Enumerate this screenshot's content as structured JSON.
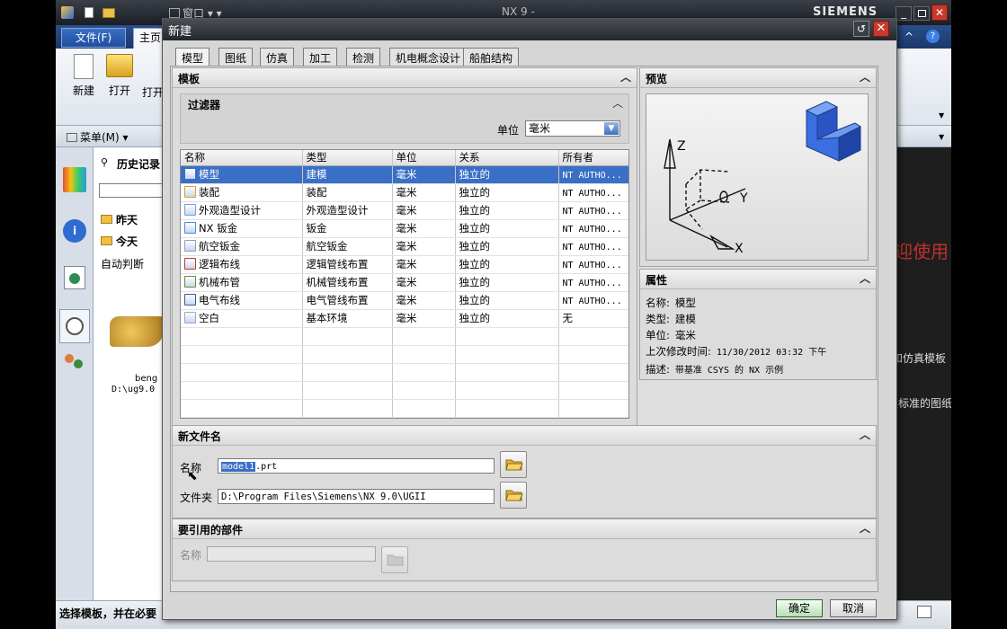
{
  "app": {
    "window_title": "NX 9 -",
    "brand": "SIEMENS",
    "qa_window_menu": "窗口",
    "file_tab": "文件(F)",
    "home_tab": "主页",
    "ribbon_new": "新建",
    "ribbon_open": "打开",
    "ribbon_open_recent": "打开",
    "menu_button": "菜单(M)",
    "history_title": "历史记录",
    "history_yesterday": "昨天",
    "history_today": "今天",
    "history_auto": "自动判断",
    "history_item_name": "beng",
    "history_item_path": "D:\\ug9.0",
    "right_welcome": "欢迎使用",
    "right_text1": "和仿真模板",
    "right_text2": "义标准的图纸",
    "status_text": "选择模板，并在必要"
  },
  "dialog": {
    "title": "新建",
    "tabs": [
      "模型",
      "图纸",
      "仿真",
      "加工",
      "检测",
      "机电概念设计",
      "船舶结构"
    ],
    "templates_header": "模板",
    "filter_header": "过滤器",
    "unit_label": "单位",
    "unit_value": "毫米",
    "columns": [
      "名称",
      "类型",
      "单位",
      "关系",
      "所有者"
    ],
    "rows": [
      {
        "name": "模型",
        "type": "建模",
        "unit": "毫米",
        "relation": "独立的",
        "owner": "NT AUTHO..."
      },
      {
        "name": "装配",
        "type": "装配",
        "unit": "毫米",
        "relation": "独立的",
        "owner": "NT AUTHO..."
      },
      {
        "name": "外观造型设计",
        "type": "外观造型设计",
        "unit": "毫米",
        "relation": "独立的",
        "owner": "NT AUTHO..."
      },
      {
        "name": "NX 钣金",
        "type": "钣金",
        "unit": "毫米",
        "relation": "独立的",
        "owner": "NT AUTHO..."
      },
      {
        "name": "航空钣金",
        "type": "航空钣金",
        "unit": "毫米",
        "relation": "独立的",
        "owner": "NT AUTHO..."
      },
      {
        "name": "逻辑布线",
        "type": "逻辑管线布置",
        "unit": "毫米",
        "relation": "独立的",
        "owner": "NT AUTHO..."
      },
      {
        "name": "机械布管",
        "type": "机械管线布置",
        "unit": "毫米",
        "relation": "独立的",
        "owner": "NT AUTHO..."
      },
      {
        "name": "电气布线",
        "type": "电气管线布置",
        "unit": "毫米",
        "relation": "独立的",
        "owner": "NT AUTHO..."
      },
      {
        "name": "空白",
        "type": "基本环境",
        "unit": "毫米",
        "relation": "独立的",
        "owner": "无"
      }
    ],
    "preview_header": "预览",
    "preview_axis_z": "Z",
    "preview_axis_y": "Y",
    "preview_axis_x": "X",
    "properties_header": "属性",
    "properties": [
      {
        "label": "名称:",
        "value": "模型"
      },
      {
        "label": "类型:",
        "value": "建模"
      },
      {
        "label": "单位:",
        "value": "毫米"
      },
      {
        "label": "上次修改时间:",
        "value": "11/30/2012 03:32 下午"
      },
      {
        "label": "描述:",
        "value": "带基准 CSYS 的 NX 示例"
      }
    ],
    "newfile_header": "新文件名",
    "name_label": "名称",
    "name_value_selected": "model1",
    "name_value_rest": ".prt",
    "folder_label": "文件夹",
    "folder_value": "D:\\Program Files\\Siemens\\NX 9.0\\UGII",
    "ref_header": "要引用的部件",
    "ref_name_label": "名称",
    "ok_button": "确定",
    "cancel_button": "取消"
  }
}
